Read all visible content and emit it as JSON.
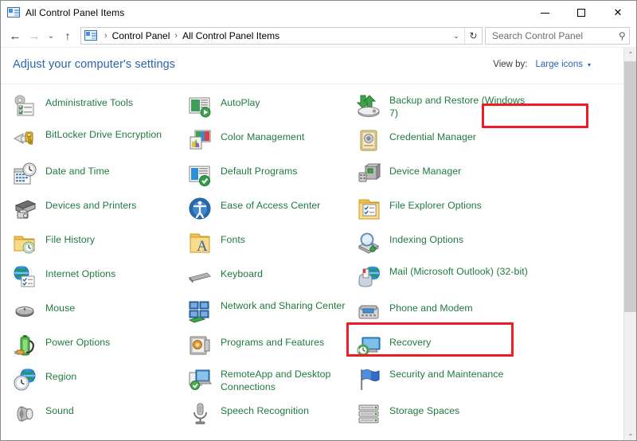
{
  "window": {
    "title": "All Control Panel Items",
    "title_icon": "control-panel-icon",
    "caption": {
      "minimize": "Minimize",
      "maximize": "Maximize",
      "close": "Close"
    }
  },
  "navigation": {
    "back": "←",
    "forward": "→",
    "recent": "⌄",
    "up": "↑",
    "breadcrumb": {
      "icon": "control-panel-icon",
      "items": [
        "Control Panel",
        "All Control Panel Items"
      ],
      "separator": "›"
    },
    "dropdown_caret": "⌄",
    "refresh": "↻"
  },
  "search": {
    "placeholder": "Search Control Panel",
    "value": "",
    "icon": "search-icon"
  },
  "main": {
    "heading": "Adjust your computer's settings",
    "view_by": {
      "label": "View by:",
      "value": "Large icons",
      "caret": "▾"
    }
  },
  "columns": [
    {
      "id": "column-1",
      "items": [
        {
          "label": "Administrative Tools",
          "icon": "administrative-tools-icon"
        },
        {
          "label": "BitLocker Drive Encryption",
          "icon": "bitlocker-icon"
        },
        {
          "label": "Date and Time",
          "icon": "date-and-time-icon"
        },
        {
          "label": "Devices and Printers",
          "icon": "devices-and-printers-icon"
        },
        {
          "label": "File History",
          "icon": "file-history-icon"
        },
        {
          "label": "Internet Options",
          "icon": "internet-options-icon"
        },
        {
          "label": "Mouse",
          "icon": "mouse-icon"
        },
        {
          "label": "Power Options",
          "icon": "power-options-icon"
        },
        {
          "label": "Region",
          "icon": "region-icon"
        },
        {
          "label": "Sound",
          "icon": "sound-icon"
        }
      ]
    },
    {
      "id": "column-2",
      "items": [
        {
          "label": "AutoPlay",
          "icon": "autoplay-icon"
        },
        {
          "label": "Color Management",
          "icon": "color-management-icon"
        },
        {
          "label": "Default Programs",
          "icon": "default-programs-icon"
        },
        {
          "label": "Ease of Access Center",
          "icon": "ease-of-access-icon"
        },
        {
          "label": "Fonts",
          "icon": "fonts-icon"
        },
        {
          "label": "Keyboard",
          "icon": "keyboard-icon"
        },
        {
          "label": "Network and Sharing Center",
          "icon": "network-sharing-icon"
        },
        {
          "label": "Programs and Features",
          "icon": "programs-and-features-icon"
        },
        {
          "label": "RemoteApp and Desktop Connections",
          "icon": "remoteapp-icon"
        },
        {
          "label": "Speech Recognition",
          "icon": "speech-recognition-icon"
        }
      ]
    },
    {
      "id": "column-3",
      "items": [
        {
          "label": "Backup and Restore (Windows 7)",
          "icon": "backup-and-restore-icon"
        },
        {
          "label": "Credential Manager",
          "icon": "credential-manager-icon"
        },
        {
          "label": "Device Manager",
          "icon": "device-manager-icon"
        },
        {
          "label": "File Explorer Options",
          "icon": "file-explorer-options-icon"
        },
        {
          "label": "Indexing Options",
          "icon": "indexing-options-icon"
        },
        {
          "label": "Mail (Microsoft Outlook) (32-bit)",
          "icon": "mail-icon"
        },
        {
          "label": "Phone and Modem",
          "icon": "phone-and-modem-icon"
        },
        {
          "label": "Recovery",
          "icon": "recovery-icon"
        },
        {
          "label": "Security and Maintenance",
          "icon": "security-and-maintenance-icon"
        },
        {
          "label": "Storage Spaces",
          "icon": "storage-spaces-icon"
        }
      ]
    }
  ],
  "annotations": [
    {
      "id": "redbox-viewby",
      "target": "View by: Large icons",
      "color": "#ee1c25"
    },
    {
      "id": "redbox-mail",
      "target": "Mail (Microsoft Outlook) (32-bit)",
      "color": "#ee1c25"
    }
  ],
  "scrollbar": {
    "up_arrow": "⌃",
    "down_arrow": "⌄"
  },
  "colors": {
    "link": "#2a63b0",
    "item_label": "#1f7a3d",
    "annotation": "#ee1c25"
  }
}
